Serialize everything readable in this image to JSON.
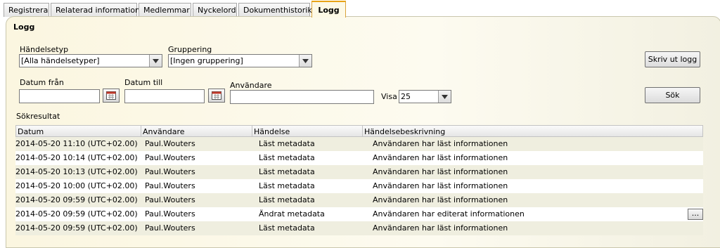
{
  "tabs": [
    "Registrera",
    "Relaterad information",
    "Medlemmar",
    "Nyckelord",
    "Dokumenthistorik",
    "Logg"
  ],
  "active_tab": "Logg",
  "section_title": "Logg",
  "filters": {
    "event_type_label": "Händelsetyp",
    "event_type_value": "[Alla händelsetyper]",
    "grouping_label": "Gruppering",
    "grouping_value": "[Ingen gruppering]",
    "date_from_label": "Datum från",
    "date_from_value": "",
    "date_to_label": "Datum till",
    "date_to_value": "",
    "user_label": "Användare",
    "user_value": "",
    "show_label": "Visa",
    "show_value": "25"
  },
  "buttons": {
    "print_log": "Skriv ut logg",
    "search": "Sök"
  },
  "results_label": "Sökresultat",
  "columns": [
    "Datum",
    "Användare",
    "Händelse",
    "Händelsebeskrivning"
  ],
  "rows": [
    {
      "date": "2014-05-20 11:10 (UTC+02.00)",
      "user": "Paul.Wouters",
      "event": "Läst metadata",
      "description": "Användaren har läst informationen"
    },
    {
      "date": "2014-05-20 10:14 (UTC+02.00)",
      "user": "Paul.Wouters",
      "event": "Läst metadata",
      "description": "Användaren har läst informationen"
    },
    {
      "date": "2014-05-20 10:13 (UTC+02.00)",
      "user": "Paul.Wouters",
      "event": "Läst metadata",
      "description": "Användaren har läst informationen"
    },
    {
      "date": "2014-05-20 10:00 (UTC+02.00)",
      "user": "Paul.Wouters",
      "event": "Läst metadata",
      "description": "Användaren har läst informationen"
    },
    {
      "date": "2014-05-20 09:59 (UTC+02.00)",
      "user": "Paul.Wouters",
      "event": "Läst metadata",
      "description": "Användaren har läst informationen"
    },
    {
      "date": "2014-05-20 09:59 (UTC+02.00)",
      "user": "Paul.Wouters",
      "event": "Ändrat metadata",
      "description": "Användaren har editerat informationen",
      "more": "..."
    },
    {
      "date": "2014-05-20 09:59 (UTC+02.00)",
      "user": "Paul.Wouters",
      "event": "Läst metadata",
      "description": "Användaren har läst informationen"
    }
  ],
  "colors": {
    "active_tab_border": "#e8a317",
    "panel_bg": "#fbf6e0",
    "row_alt": "#efeedf"
  }
}
